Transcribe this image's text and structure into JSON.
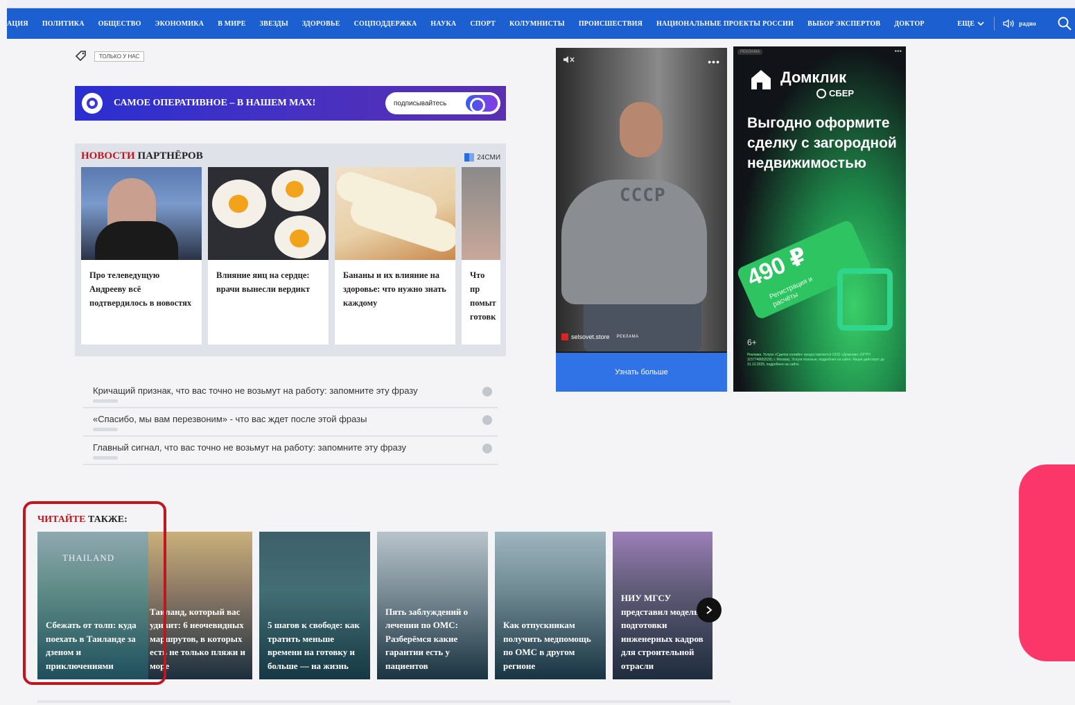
{
  "nav": {
    "items": [
      "АЦИЯ",
      "ПОЛИТИКА",
      "ОБЩЕСТВО",
      "ЭКОНОМИКА",
      "В МИРЕ",
      "ЗВЕЗДЫ",
      "ЗДОРОВЬЕ",
      "СОЦПОДДЕРЖКА",
      "НАУКА",
      "СПОРТ",
      "КОЛУМНИСТЫ",
      "ПРОИСШЕСТВИЯ",
      "НАЦИОНАЛЬНЫЕ ПРОЕКТЫ РОССИИ",
      "ВЫБОР ЭКСПЕРТОВ",
      "ДОКТОР"
    ],
    "more": "ЕЩЕ",
    "radio": "радио",
    "bg_color": "#1b5fd1"
  },
  "tag": {
    "label": "ТОЛЬКО У НАС"
  },
  "max_banner": {
    "text": "САМОЕ ОПЕРАТИВНОЕ – В НАШЕМ MAX!",
    "button": "подписывайтесь"
  },
  "partners": {
    "title_red": "НОВОСТИ",
    "title_rest": "ПАРТНЁРОВ",
    "source": "24СМИ",
    "cards": [
      {
        "text": "Про телеведущую Андрееву всё подтвердилось в новостях"
      },
      {
        "text": "Влияние яиц на сердце: врачи вынесли вердикт"
      },
      {
        "text": "Бананы и их влияние на здоровье: что нужно знать каждому"
      },
      {
        "text": "Что пр помыт готовк"
      }
    ]
  },
  "news_list": [
    {
      "text": "Кричащий признак, что вас точно не возьмут на работу: запомните эту фразу"
    },
    {
      "text": "«Спасибо, мы вам перезвоним» - что вас ждет после этой фразы"
    },
    {
      "text": "Главный сигнал, что вас точно не возьмут на работу: запомните эту фразу"
    }
  ],
  "ad_video": {
    "shirt_text": "СССР",
    "source": "selsovet.store",
    "ad_label": "РЕКЛАМА",
    "cta": "Узнать больше"
  },
  "ad_dom": {
    "tag": "РЕКЛАМА",
    "brand": "Домклик",
    "sub_brand": "СБЕР",
    "headline": "Выгодно оформите сделку с загородной недвижимостью",
    "price": "490 ₽",
    "reg": "Регистрация и расчёты",
    "age": "6+",
    "legal": "Реклама. Услуга «Сделка онлайн» предоставляется ООО «Домклик» (ОГРН 1157746652150, г. Москва). Услуги платные, подробнее на сайте. Акция действует до 31.12.2025, подробнее на сайте."
  },
  "read_also": {
    "title_red": "ЧИТАЙТЕ",
    "title_rest": "ТАКЖЕ:",
    "cards": [
      {
        "text": "Сбежать от толп: куда поехать в Таиланде за дзеном и приключениями",
        "logo": "THAILAND"
      },
      {
        "text": "Таиланд, который вас удивит: 6 неочевидных маршрутов, в которых есть не только пляжи и море"
      },
      {
        "text": "5 шагов к свободе: как тратить меньше времени на готовку и больше — на жизнь"
      },
      {
        "text": "Пять заблуждений о лечении по ОМС: Разберёмся какие гарантии есть у пациентов"
      },
      {
        "text": "Как отпускникам получить медпомощь по ОМС в другом регионе"
      },
      {
        "text": "НИУ МГСУ представил модель подготовки инженерных кадров для строительной отрасли"
      }
    ]
  },
  "colors": {
    "accent_red": "#c0141b",
    "highlight": "#c0161e",
    "pink": "#fa3768"
  }
}
